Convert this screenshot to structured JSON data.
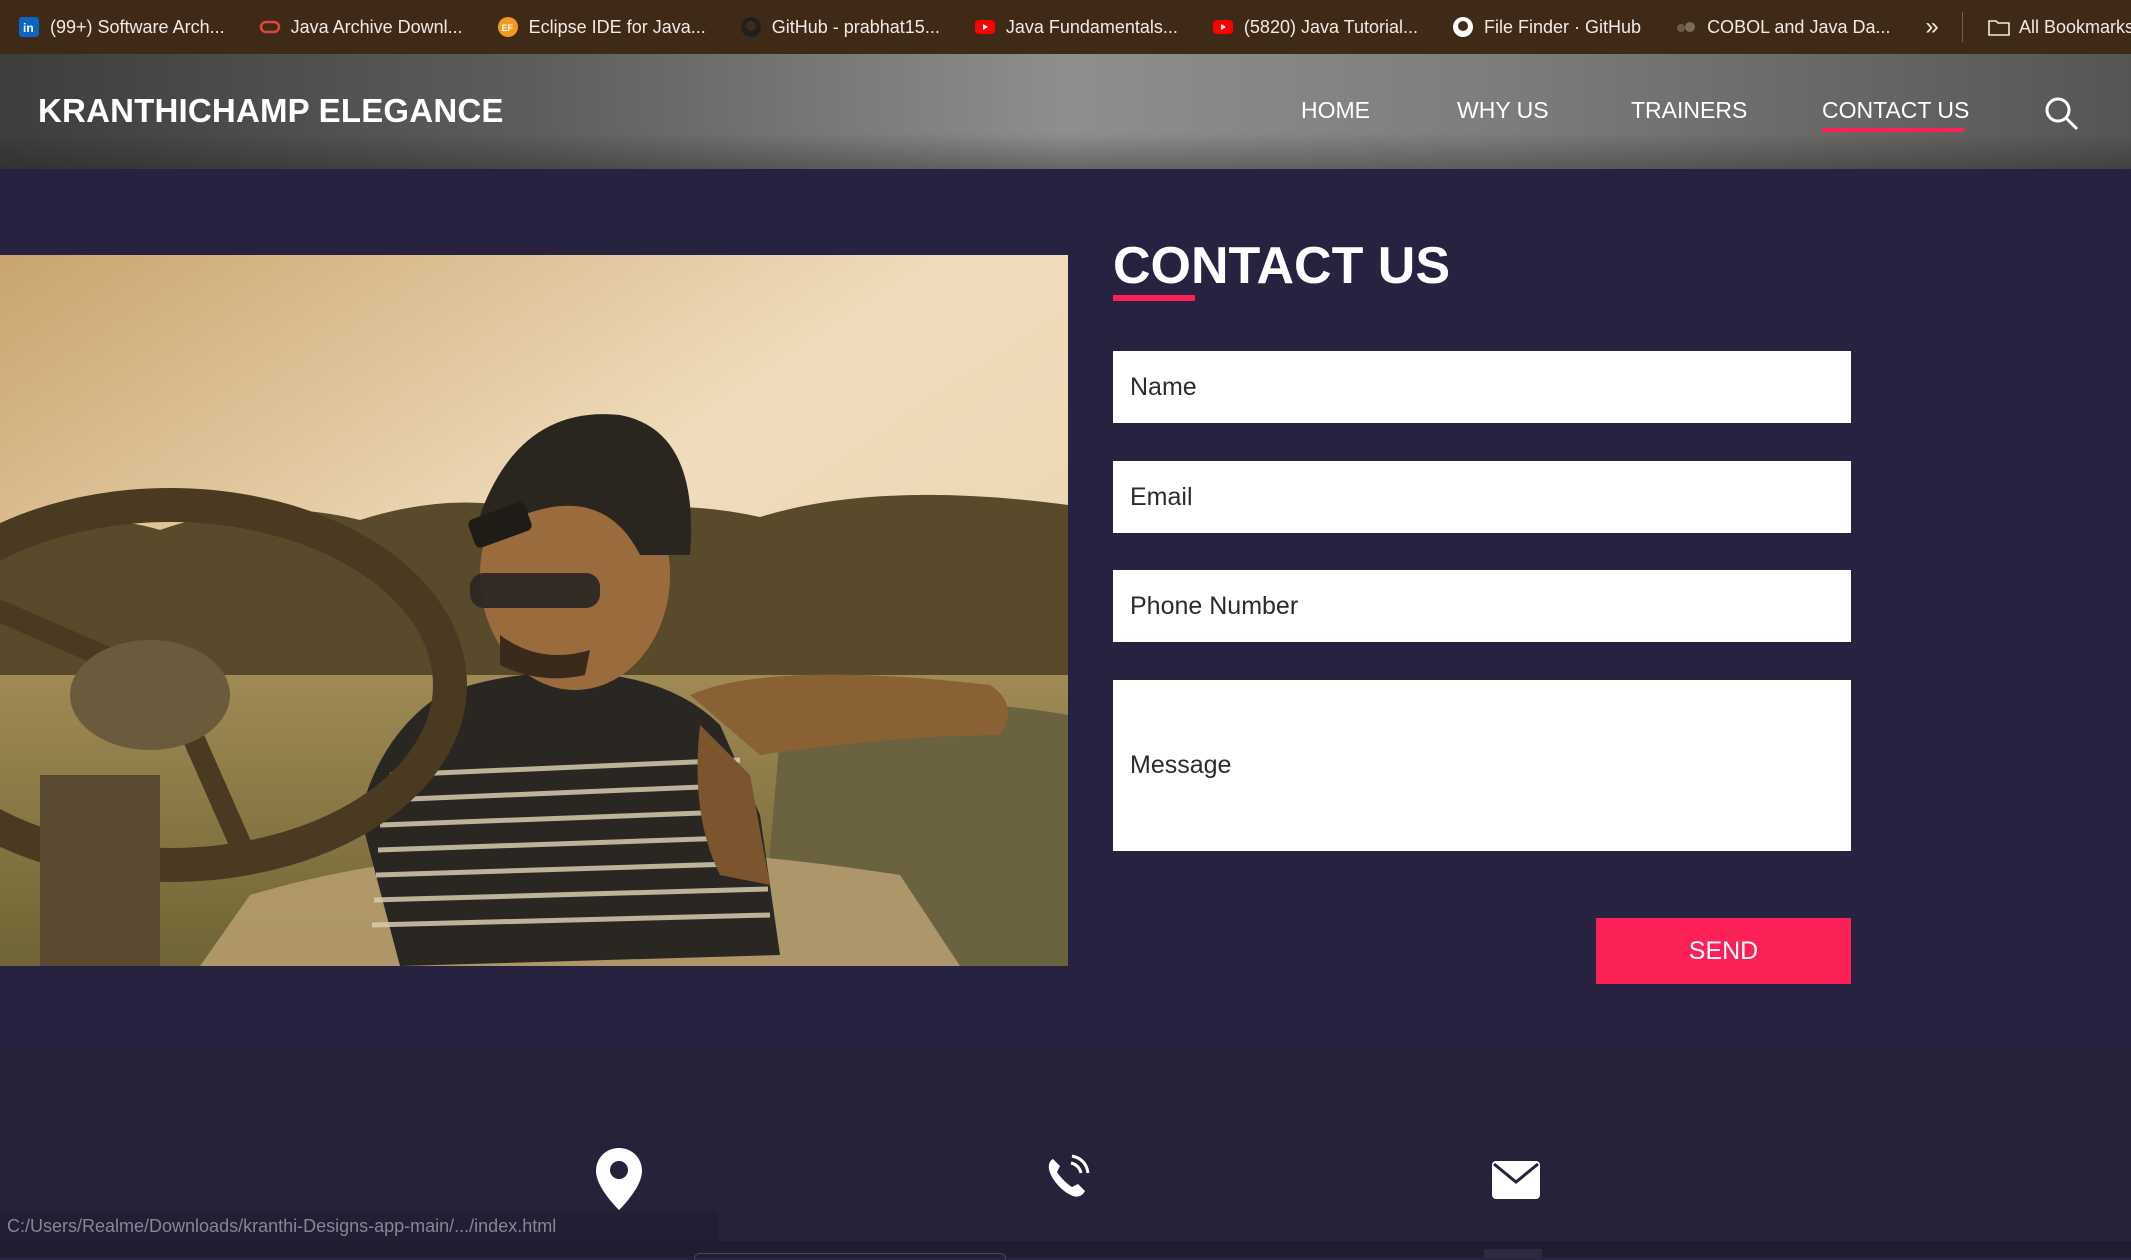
{
  "bookmarks": {
    "items": [
      {
        "label": "(99+) Software Arch...",
        "icon": "linkedin-icon"
      },
      {
        "label": "Java Archive Downl...",
        "icon": "oracle-icon"
      },
      {
        "label": "Eclipse IDE for Java...",
        "icon": "eclipse-icon"
      },
      {
        "label": "GitHub - prabhat15...",
        "icon": "github-icon"
      },
      {
        "label": "Java Fundamentals...",
        "icon": "youtube-icon"
      },
      {
        "label": "(5820) Java Tutorial...",
        "icon": "youtube-icon"
      },
      {
        "label": "File Finder · GitHub",
        "icon": "github-icon"
      },
      {
        "label": "COBOL and Java Da...",
        "icon": "site-icon"
      }
    ],
    "more": "»",
    "all_bookmarks": "All Bookmarks"
  },
  "header": {
    "brand": "KRANTHICHAMP ELEGANCE",
    "nav": {
      "home": "HOME",
      "why_us": "WHY US",
      "trainers": "TRAINERS",
      "contact_us": "CONTACT US"
    },
    "active_nav": "CONTACT US"
  },
  "contact": {
    "title": "CONTACT US",
    "name_placeholder": "Name",
    "email_placeholder": "Email",
    "phone_placeholder": "Phone Number",
    "message_placeholder": "Message",
    "send_label": "SEND"
  },
  "footer": {
    "icons": [
      "location-pin-icon",
      "phone-icon",
      "envelope-icon"
    ]
  },
  "status_bar": {
    "url": "C:/Users/Realme/Downloads/kranthi-Designs-app-main/.../index.html"
  },
  "colors": {
    "accent": "#fb2056",
    "background": "#26223f",
    "bookmarks_bar": "#3f2a17"
  }
}
